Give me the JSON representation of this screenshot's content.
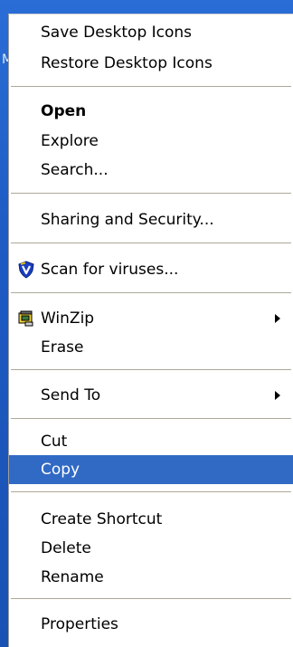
{
  "desktop": {
    "edge_letter": "M"
  },
  "context_menu": {
    "items": [
      {
        "label": "Save Desktop Icons"
      },
      {
        "label": "Restore Desktop Icons"
      },
      {
        "label": "Open"
      },
      {
        "label": "Explore"
      },
      {
        "label": "Search..."
      },
      {
        "label": "Sharing and Security..."
      },
      {
        "label": "Scan for viruses...",
        "icon": "antivirus-shield-icon"
      },
      {
        "label": "WinZip",
        "icon": "winzip-icon"
      },
      {
        "label": "Erase"
      },
      {
        "label": "Send To"
      },
      {
        "label": "Cut"
      },
      {
        "label": "Copy"
      },
      {
        "label": "Create Shortcut"
      },
      {
        "label": "Delete"
      },
      {
        "label": "Rename"
      },
      {
        "label": "Properties"
      }
    ],
    "selected_item": "Copy",
    "colors": {
      "selection_bg": "#316ac5",
      "selection_text": "#ffffff",
      "separator": "#aca899",
      "desktop": "#1f5dbf"
    }
  }
}
